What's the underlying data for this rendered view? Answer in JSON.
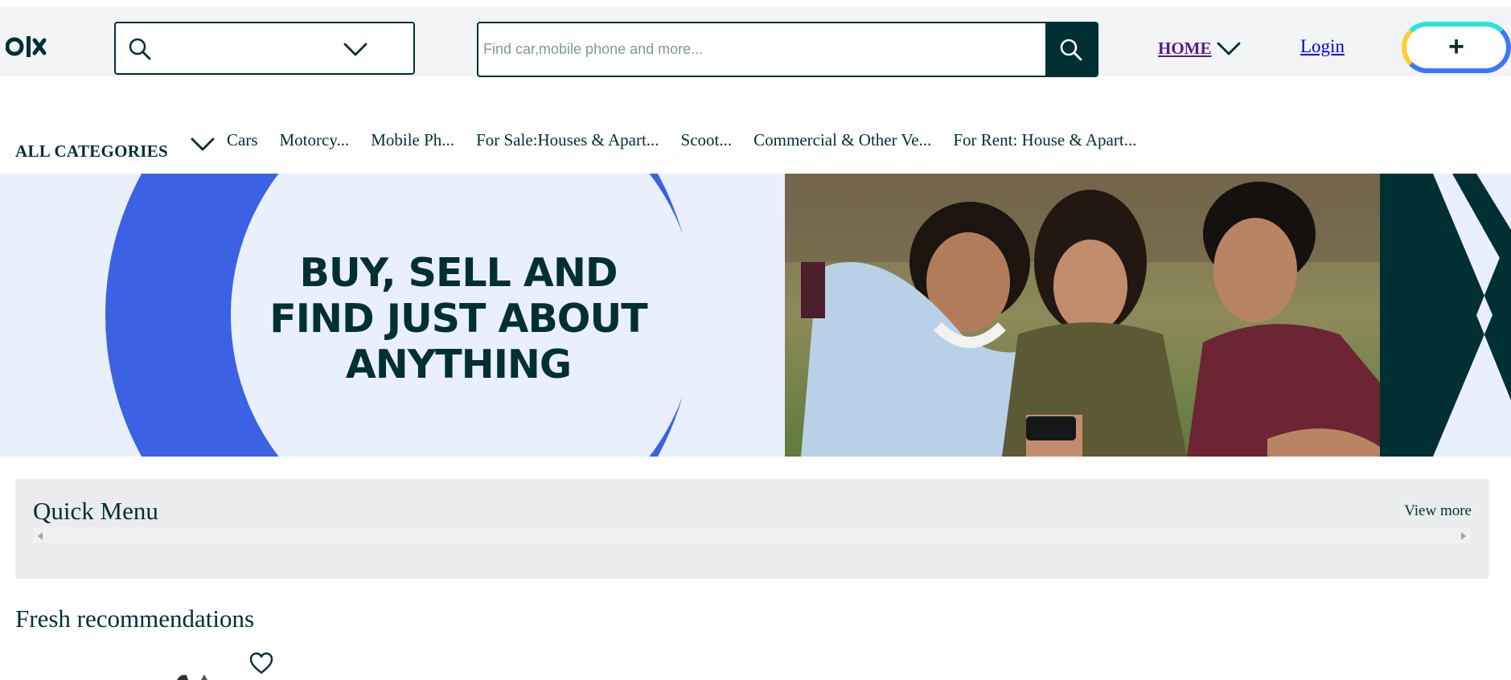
{
  "header": {
    "logo_text": "OLX",
    "location_value": "",
    "search_placeholder": "Find car,mobile phone and more...",
    "home_label": "HOME",
    "login_label": "Login",
    "sell_label": "+"
  },
  "categories": {
    "all_label": "ALL CATEGORIES",
    "items": [
      "Cars",
      "Motorcy...",
      "Mobile Ph...",
      "For Sale:Houses & Apart...",
      "Scoot...",
      "Commercial & Other Ve...",
      "For Rent: House & Apart..."
    ]
  },
  "banner": {
    "line1": "BUY, SELL AND",
    "line2": "FIND JUST ABOUT",
    "line3": "ANYTHING"
  },
  "quick_menu": {
    "title": "Quick Menu",
    "view_more": "View more"
  },
  "fresh": {
    "title": "Fresh recommendations"
  },
  "colors": {
    "brand_dark": "#002f34",
    "banner_blue": "#3a62e3",
    "banner_light": "#e9f0fc",
    "sell_teal": "#23e5db",
    "sell_yellow": "#ffce32",
    "sell_blue": "#3a77ff"
  },
  "icons": [
    "olx-logo-icon",
    "search-icon",
    "chevron-down-icon",
    "heart-icon",
    "plus-icon"
  ]
}
